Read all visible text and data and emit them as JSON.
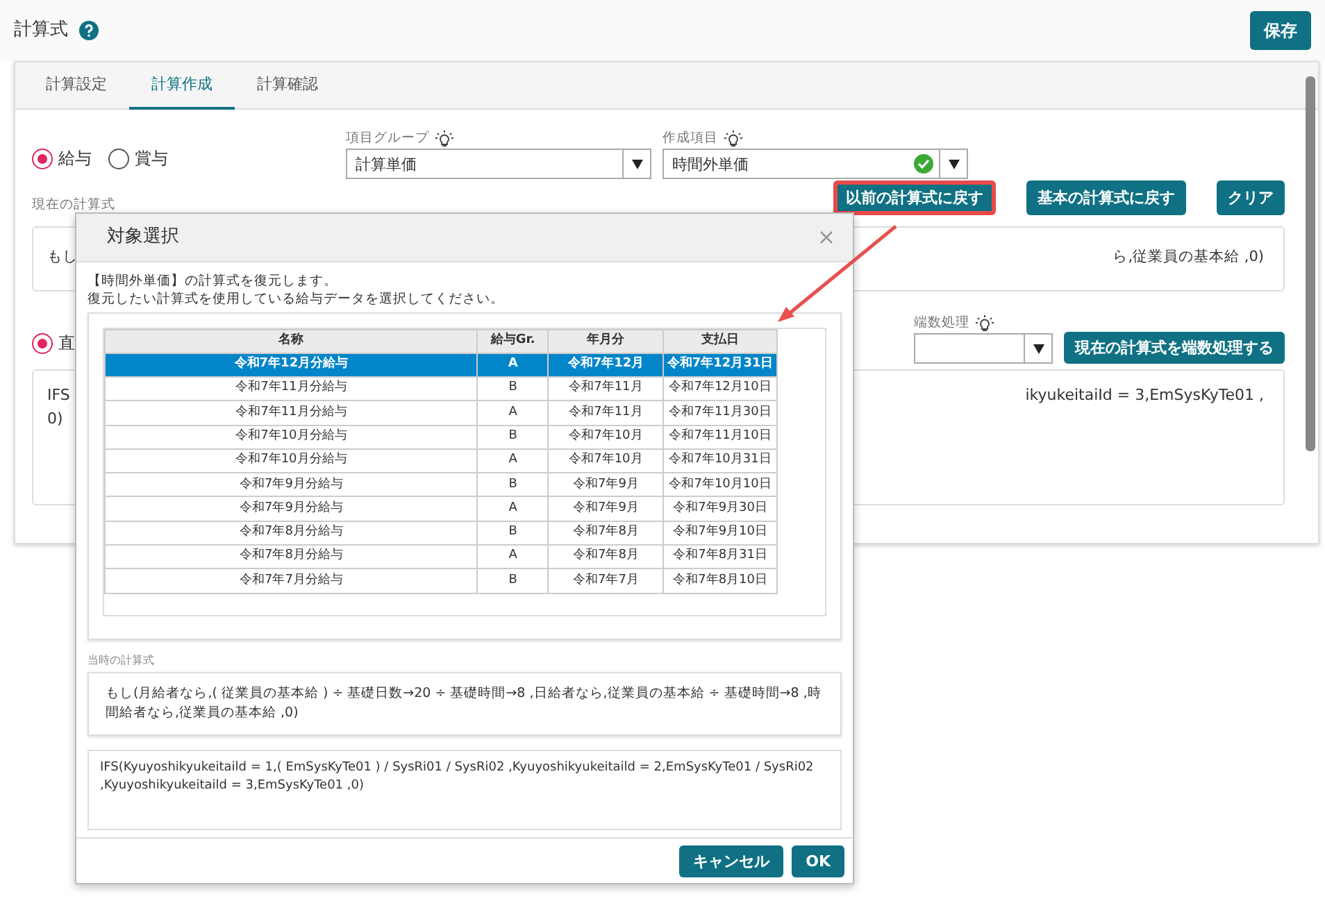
{
  "page": {
    "title": "計算式",
    "save_button": "保存"
  },
  "tabs": [
    {
      "label": "計算設定",
      "selected": false
    },
    {
      "label": "計算作成",
      "selected": true
    },
    {
      "label": "計算確認",
      "selected": false
    }
  ],
  "pay_types": [
    {
      "label": "給与",
      "checked": true
    },
    {
      "label": "賞与",
      "checked": false
    }
  ],
  "item_group": {
    "label": "項目グループ",
    "value": "計算単価"
  },
  "created_item": {
    "label": "作成項目",
    "value": "時間外単価",
    "valid": true
  },
  "current_formula": {
    "label": "現在の計算式",
    "buttons": [
      {
        "label": "以前の計算式に戻す",
        "highlighted": true
      },
      {
        "label": "基本の計算式に戻す",
        "highlighted": false
      },
      {
        "label": "クリア",
        "highlighted": false
      }
    ],
    "text_left": "もし",
    "text_right": "ら,従業員の基本給 ,0)"
  },
  "direct": {
    "label": "直",
    "checked": true
  },
  "rounding": {
    "label": "端数処理",
    "button": "現在の計算式を端数処理する"
  },
  "code_formula": {
    "lines_left": [
      "IFS",
      "0)"
    ],
    "text_right": "ikyukeitaiId = 3,EmSysKyTe01 ,"
  },
  "dialog": {
    "title": "対象選択",
    "message": [
      "【時間外単価】の計算式を復元します。",
      "復元したい計算式を使用している給与データを選択してください。"
    ],
    "columns": [
      "名称",
      "給与Gr.",
      "年月分",
      "支払日"
    ],
    "rows": [
      {
        "cells": [
          "令和7年12月分給与",
          "A",
          "令和7年12月",
          "令和7年12月31日"
        ],
        "selected": true
      },
      {
        "cells": [
          "令和7年11月分給与",
          "B",
          "令和7年11月",
          "令和7年12月10日"
        ],
        "selected": false
      },
      {
        "cells": [
          "令和7年11月分給与",
          "A",
          "令和7年11月",
          "令和7年11月30日"
        ],
        "selected": false
      },
      {
        "cells": [
          "令和7年10月分給与",
          "B",
          "令和7年10月",
          "令和7年11月10日"
        ],
        "selected": false
      },
      {
        "cells": [
          "令和7年10月分給与",
          "A",
          "令和7年10月",
          "令和7年10月31日"
        ],
        "selected": false
      },
      {
        "cells": [
          "令和7年9月分給与",
          "B",
          "令和7年9月",
          "令和7年10月10日"
        ],
        "selected": false
      },
      {
        "cells": [
          "令和7年9月分給与",
          "A",
          "令和7年9月",
          "令和7年9月30日"
        ],
        "selected": false
      },
      {
        "cells": [
          "令和7年8月分給与",
          "B",
          "令和7年8月",
          "令和7年9月10日"
        ],
        "selected": false
      },
      {
        "cells": [
          "令和7年8月分給与",
          "A",
          "令和7年8月",
          "令和7年8月31日"
        ],
        "selected": false
      },
      {
        "cells": [
          "令和7年7月分給与",
          "B",
          "令和7年7月",
          "令和7年8月10日"
        ],
        "selected": false
      }
    ],
    "formula_label": "当時の計算式",
    "formula_text": "もし(月給者なら,( 従業員の基本給 ) ÷ 基礎日数→20 ÷ 基礎時間→8 ,日給者なら,従業員の基本給 ÷ 基礎時間→8 ,時間給者なら,従業員の基本給 ,0)",
    "formula_code": "IFS(Kyuyoshikyukeitaild = 1,( EmSysKyTe01 ) / SysRi01 / SysRi02 ,Kyuyoshikyukeitaild = 2,EmSysKyTe01 / SysRi02 ,Kyuyoshikyukeitaild = 3,EmSysKyTe01 ,0)",
    "buttons": [
      "キャンセル",
      "OK"
    ]
  }
}
